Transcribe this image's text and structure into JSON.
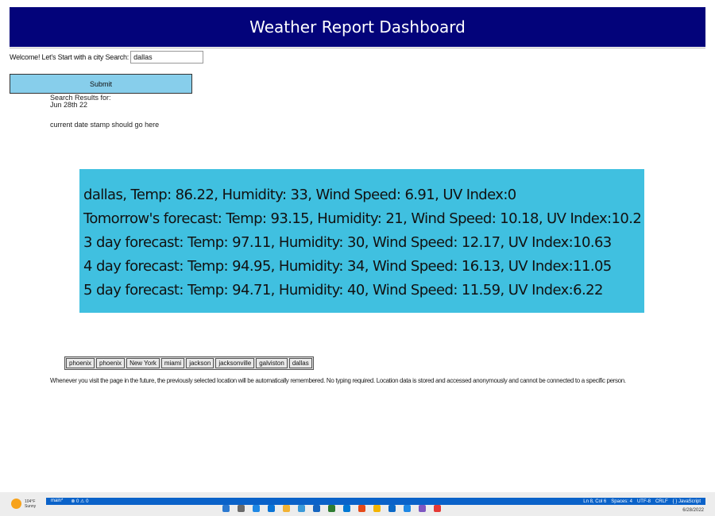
{
  "header": {
    "title": "Weather Report Dashboard"
  },
  "search": {
    "label": "Welcome! Let's Start with a city Search:",
    "value": "dallas",
    "submit_label": "Submit"
  },
  "results": {
    "heading": "Search Results for:",
    "date": "Jun 28th 22",
    "date_note": "current date stamp should go here"
  },
  "weather": {
    "lines": [
      "dallas, Temp: 86.22, Humidity: 33, Wind Speed: 6.91, UV Index:0",
      "Tomorrow's forecast: Temp: 93.15, Humidity: 21, Wind Speed: 10.18, UV Index:10.2",
      "3 day forecast: Temp: 97.11, Humidity: 30, Wind Speed: 12.17, UV Index:10.63",
      "4 day forecast: Temp: 94.95, Humidity: 34, Wind Speed: 16.13, UV Index:11.05",
      "5 day forecast: Temp: 94.71, Humidity: 40, Wind Speed: 11.59, UV Index:6.22"
    ]
  },
  "history": [
    "phoenix",
    "phoenix",
    "New York",
    "miami",
    "jackson",
    "jacksonville",
    "galviston",
    "dallas"
  ],
  "footnote": "Whenever you visit the page in the future, the previously selected location will be automatically remembered. No typing required. Location data is stored and accessed anonymously and cannot be connected to a specific person.",
  "taskbar": {
    "weather_temp": "104°F",
    "weather_cond": "Sunny",
    "branch": "main*",
    "problems": "⊗ 0 ⚠ 0",
    "cursor_pos": "Ln 8, Col 6",
    "spaces": "Spaces: 4",
    "encoding": "UTF-8",
    "eol": "CRLF",
    "language": "{ } JavaScript",
    "date": "6/28/2022",
    "icon_colors": [
      "#2b79d1",
      "#6a6a6a",
      "#1e88e5",
      "#0a74d6",
      "#f2b233",
      "#3a9ad9",
      "#1565c0",
      "#2e7d32",
      "#0078d4",
      "#e64a19",
      "#f4b400",
      "#0b69c7",
      "#1e88e5",
      "#7e57c2",
      "#e53935"
    ]
  }
}
